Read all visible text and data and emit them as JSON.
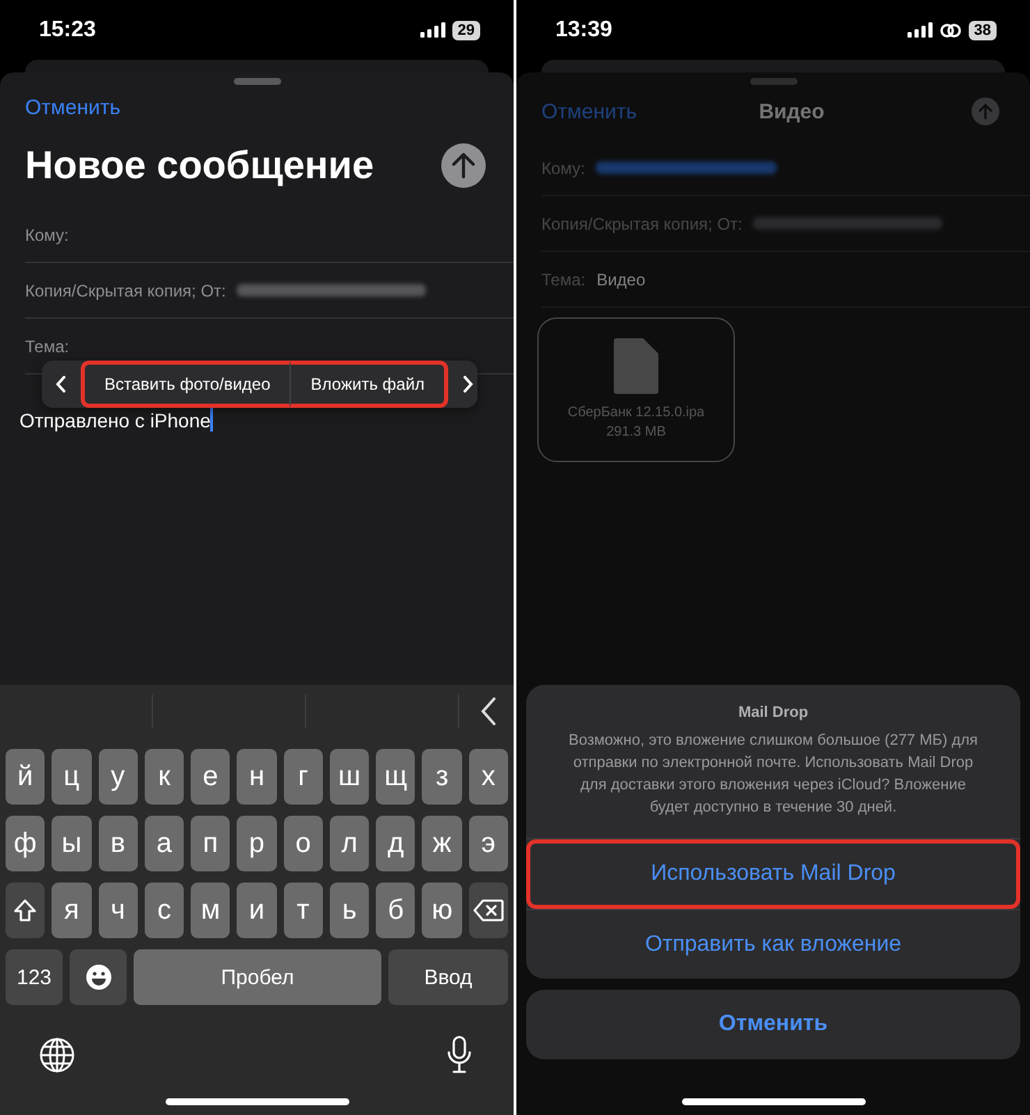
{
  "screens": [
    {
      "status_bar": {
        "time": "15:23",
        "battery": "29",
        "link": false
      },
      "dimmed": false,
      "compose": {
        "cancel": "Отменить",
        "title": "Новое сообщение",
        "large_title": true,
        "fields": [
          {
            "label": "Кому:",
            "kind": "plain"
          },
          {
            "label": "Копия/Скрытая копия; От:",
            "kind": "redacted"
          },
          {
            "label": "Тема:",
            "kind": "plain"
          }
        ]
      },
      "edit_menu": {
        "items": [
          {
            "label": "Вставить фото/видео",
            "highlighted": true
          },
          {
            "label": "Вложить файл",
            "highlighted": true
          }
        ]
      },
      "body": "Отправлено с iPhone",
      "keyboard": {
        "rows": [
          [
            "й",
            "ц",
            "у",
            "к",
            "е",
            "н",
            "г",
            "ш",
            "щ",
            "з",
            "х"
          ],
          [
            "ф",
            "ы",
            "в",
            "а",
            "п",
            "р",
            "о",
            "л",
            "д",
            "ж",
            "э"
          ],
          [
            "",
            "я",
            "ч",
            "с",
            "м",
            "и",
            "т",
            "ь",
            "б",
            "ю",
            ""
          ]
        ],
        "numbers": "123",
        "space": "Пробел",
        "return": "Ввод"
      }
    },
    {
      "status_bar": {
        "time": "13:39",
        "battery": "38",
        "link": true
      },
      "dimmed": true,
      "compose": {
        "cancel": "Отменить",
        "title": "Видео",
        "large_title": false,
        "fields": [
          {
            "label": "Кому:",
            "kind": "redacted_address"
          },
          {
            "label": "Копия/Скрытая копия; От:",
            "kind": "redacted"
          },
          {
            "label": "Тема:",
            "kind": "plain",
            "value": "Видео"
          }
        ]
      },
      "attachment": {
        "name": "СберБанк 12.15.0.ipa",
        "size": "291.3 MB"
      },
      "action_sheet": {
        "title": "Mail Drop",
        "message": "Возможно, это вложение слишком большое (277 МБ) для отправки по электронной почте. Использовать Mail Drop для доставки этого вложения через iCloud? Вложение будет доступно в течение 30 дней.",
        "actions": [
          {
            "label": "Использовать Mail Drop",
            "highlighted": true
          },
          {
            "label": "Отправить как вложение",
            "highlighted": false
          }
        ],
        "cancel": "Отменить"
      }
    }
  ]
}
